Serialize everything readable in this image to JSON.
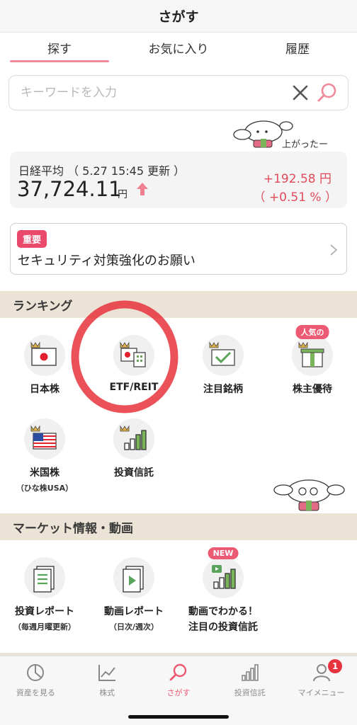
{
  "header": {
    "title": "さがす"
  },
  "tabs": [
    {
      "label": "探す"
    },
    {
      "label": "お気に入り"
    },
    {
      "label": "履歴"
    }
  ],
  "search": {
    "placeholder": "キーワードを入力",
    "value": ""
  },
  "mascot_caption": "上がったー",
  "nikkei": {
    "label": "日経平均 （ 5.27 15:45 更新 ）",
    "value": "37,724.11",
    "unit": "円",
    "change": "+192.58 円",
    "change_pct": "（ +0.51 % ）",
    "up_color": "#e04a5a"
  },
  "notice": {
    "badge": "重要",
    "text": "セキュリティ対策強化のお願い"
  },
  "ranking": {
    "title": "ランキング",
    "items": [
      {
        "label": "日本株",
        "icon": "japan-flag-icon"
      },
      {
        "label": "ETF/REIT",
        "icon": "etf-reit-icon"
      },
      {
        "label": "注目銘柄",
        "icon": "check-icon"
      },
      {
        "label": "株主優待",
        "icon": "gift-icon",
        "tag": "人気の"
      },
      {
        "label": "米国株",
        "sub": "（ひな株USA）",
        "icon": "us-flag-icon"
      },
      {
        "label": "投資信託",
        "icon": "bar-chart-icon"
      }
    ]
  },
  "market": {
    "title": "マーケット情報・動画",
    "items": [
      {
        "label": "投資レポート",
        "sub": "（毎週月曜更新）",
        "icon": "document-icon"
      },
      {
        "label": "動画レポート",
        "sub": "（日次/週次）",
        "icon": "video-icon"
      },
      {
        "label": "動画でわかる！",
        "sub": "注目の投資信託",
        "icon": "video-chart-icon",
        "tag": "NEW"
      }
    ]
  },
  "tabbar": {
    "items": [
      {
        "label": "資産を見る",
        "icon": "pie-chart-icon"
      },
      {
        "label": "株式",
        "icon": "line-chart-icon"
      },
      {
        "label": "さがす",
        "icon": "search-icon"
      },
      {
        "label": "投資信託",
        "icon": "bar-chart-icon"
      },
      {
        "label": "マイメニュー",
        "icon": "person-icon",
        "badge": "1"
      }
    ]
  },
  "colors": {
    "accent": "#ec5a74",
    "section_bg": "#ebe4d6",
    "highlight": "#e8323c"
  }
}
